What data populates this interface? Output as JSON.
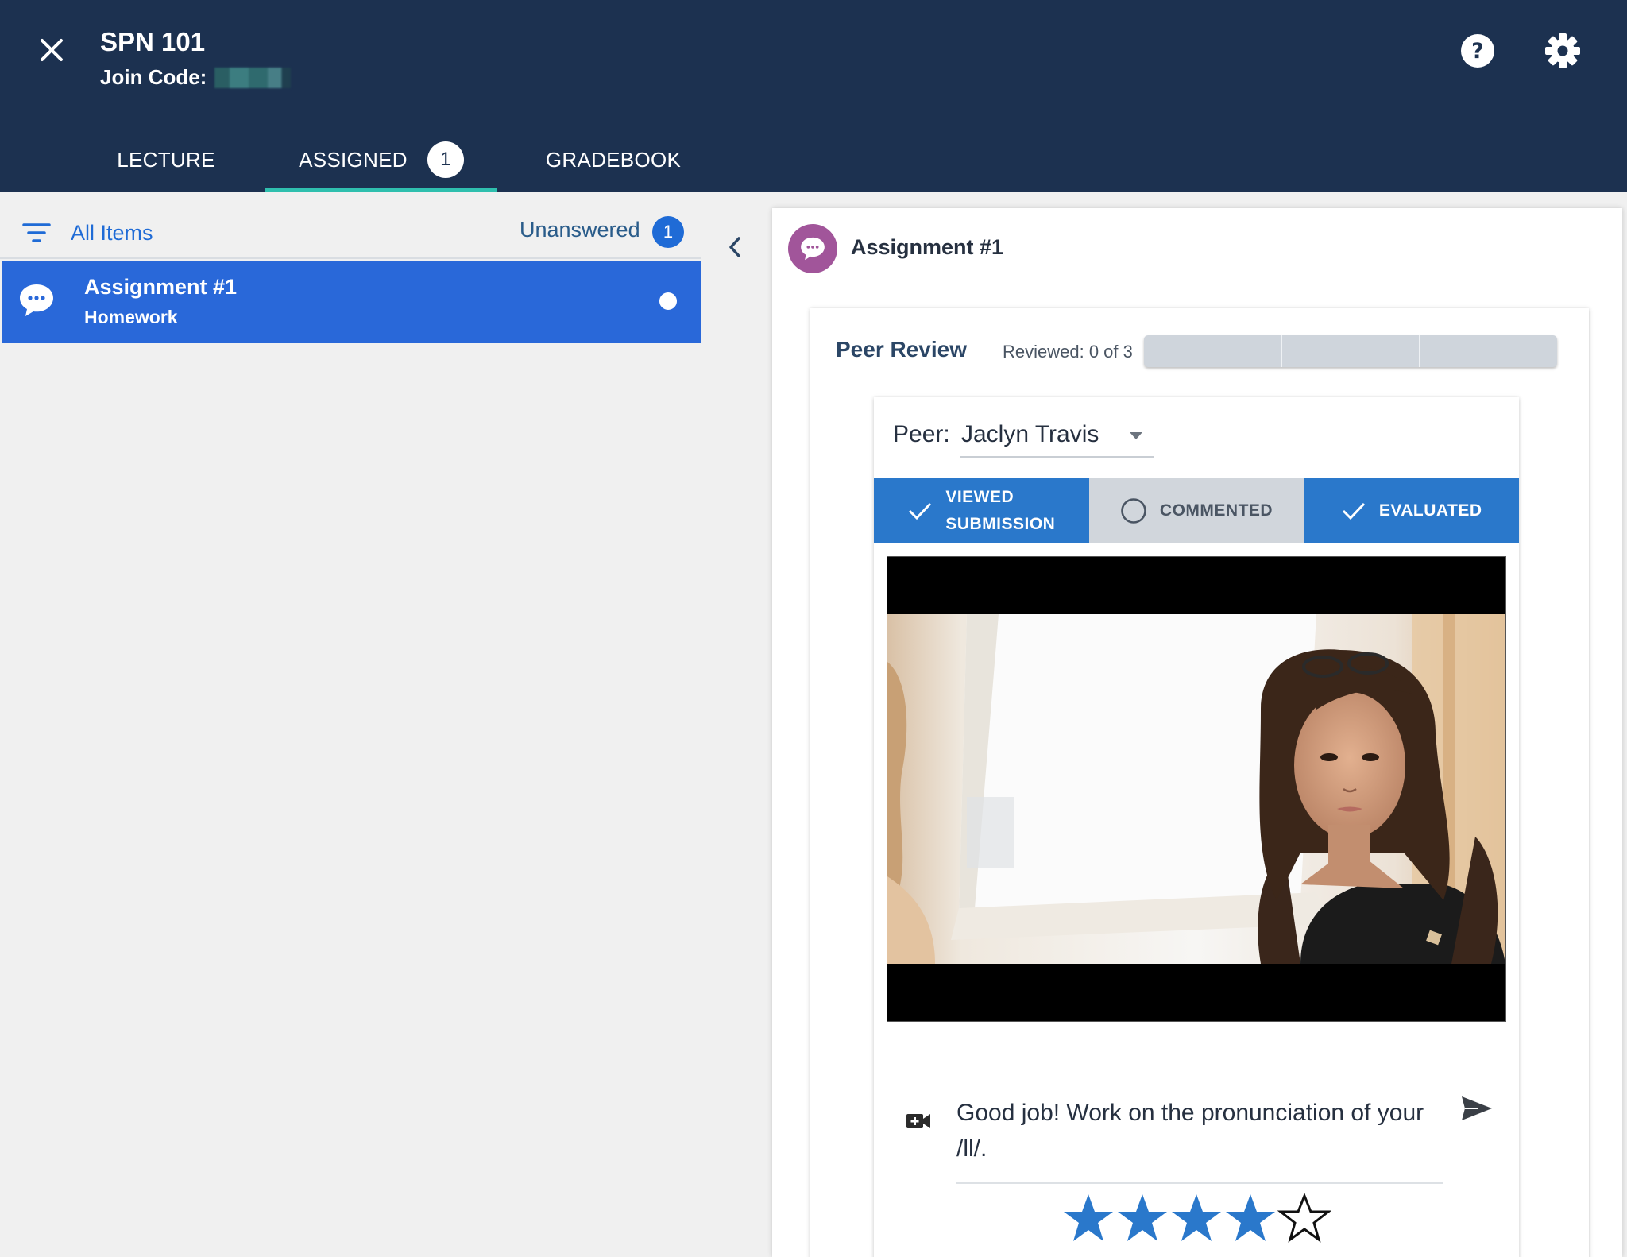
{
  "header": {
    "course_title": "SPN 101",
    "join_code_label": "Join Code:",
    "colors": {
      "bg": "#1c3150",
      "tab_indicator": "#2fbfae"
    }
  },
  "tabs": [
    {
      "label": "LECTURE",
      "active": false
    },
    {
      "label": "ASSIGNED",
      "active": true,
      "badge": "1"
    },
    {
      "label": "GRADEBOOK",
      "active": false
    }
  ],
  "left": {
    "filter_label": "All Items",
    "unanswered_label": "Unanswered",
    "unanswered_count": "1",
    "items": [
      {
        "title": "Assignment #1",
        "subtitle": "Homework",
        "icon": "chat-bubble-icon",
        "selected": true
      }
    ]
  },
  "right": {
    "assignment_title": "Assignment #1",
    "peer_review": {
      "title": "Peer Review",
      "reviewed_text": "Reviewed: 0 of 3",
      "reviewed_done": 0,
      "reviewed_total": 3
    },
    "peer": {
      "label": "Peer:",
      "selected": "Jaclyn Travis"
    },
    "steps": [
      {
        "line1": "VIEWED",
        "line2": "SUBMISSION",
        "done": true
      },
      {
        "line1": "COMMENTED",
        "line2": "",
        "done": false
      },
      {
        "line1": "EVALUATED",
        "line2": "",
        "done": true
      }
    ],
    "comment": "Good job! Work on the pronunciation of your /ll/.",
    "rating": {
      "value": 4,
      "max": 5
    }
  },
  "colors": {
    "accent": "#2968d9",
    "step_done": "#2a78cb",
    "assignment_icon": "#a1559a",
    "star": "#2a78cb"
  }
}
